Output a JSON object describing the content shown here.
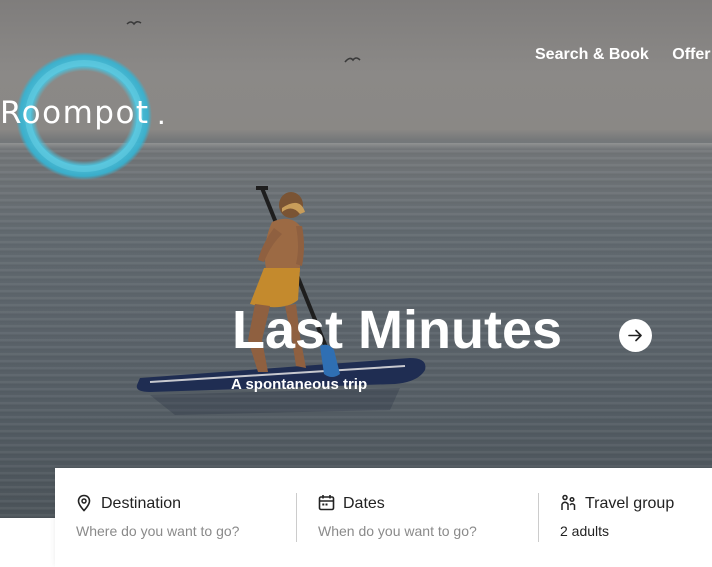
{
  "brand": {
    "logo_text": "Roompot",
    "logo_color": "#4cc2dc"
  },
  "nav": {
    "items": [
      "Search & Book",
      "Offer"
    ]
  },
  "hero": {
    "title": "Last Minutes",
    "subtitle": "A spontaneous trip"
  },
  "search": {
    "destination": {
      "label": "Destination",
      "placeholder": "Where do you want to go?"
    },
    "dates": {
      "label": "Dates",
      "placeholder": "When do you want to go?"
    },
    "travel_group": {
      "label": "Travel group",
      "value": "2 adults"
    }
  },
  "icons": {
    "destination": "map-pin-icon",
    "dates": "calendar-icon",
    "travel_group": "people-icon",
    "hero_cta": "arrow-right-icon"
  }
}
